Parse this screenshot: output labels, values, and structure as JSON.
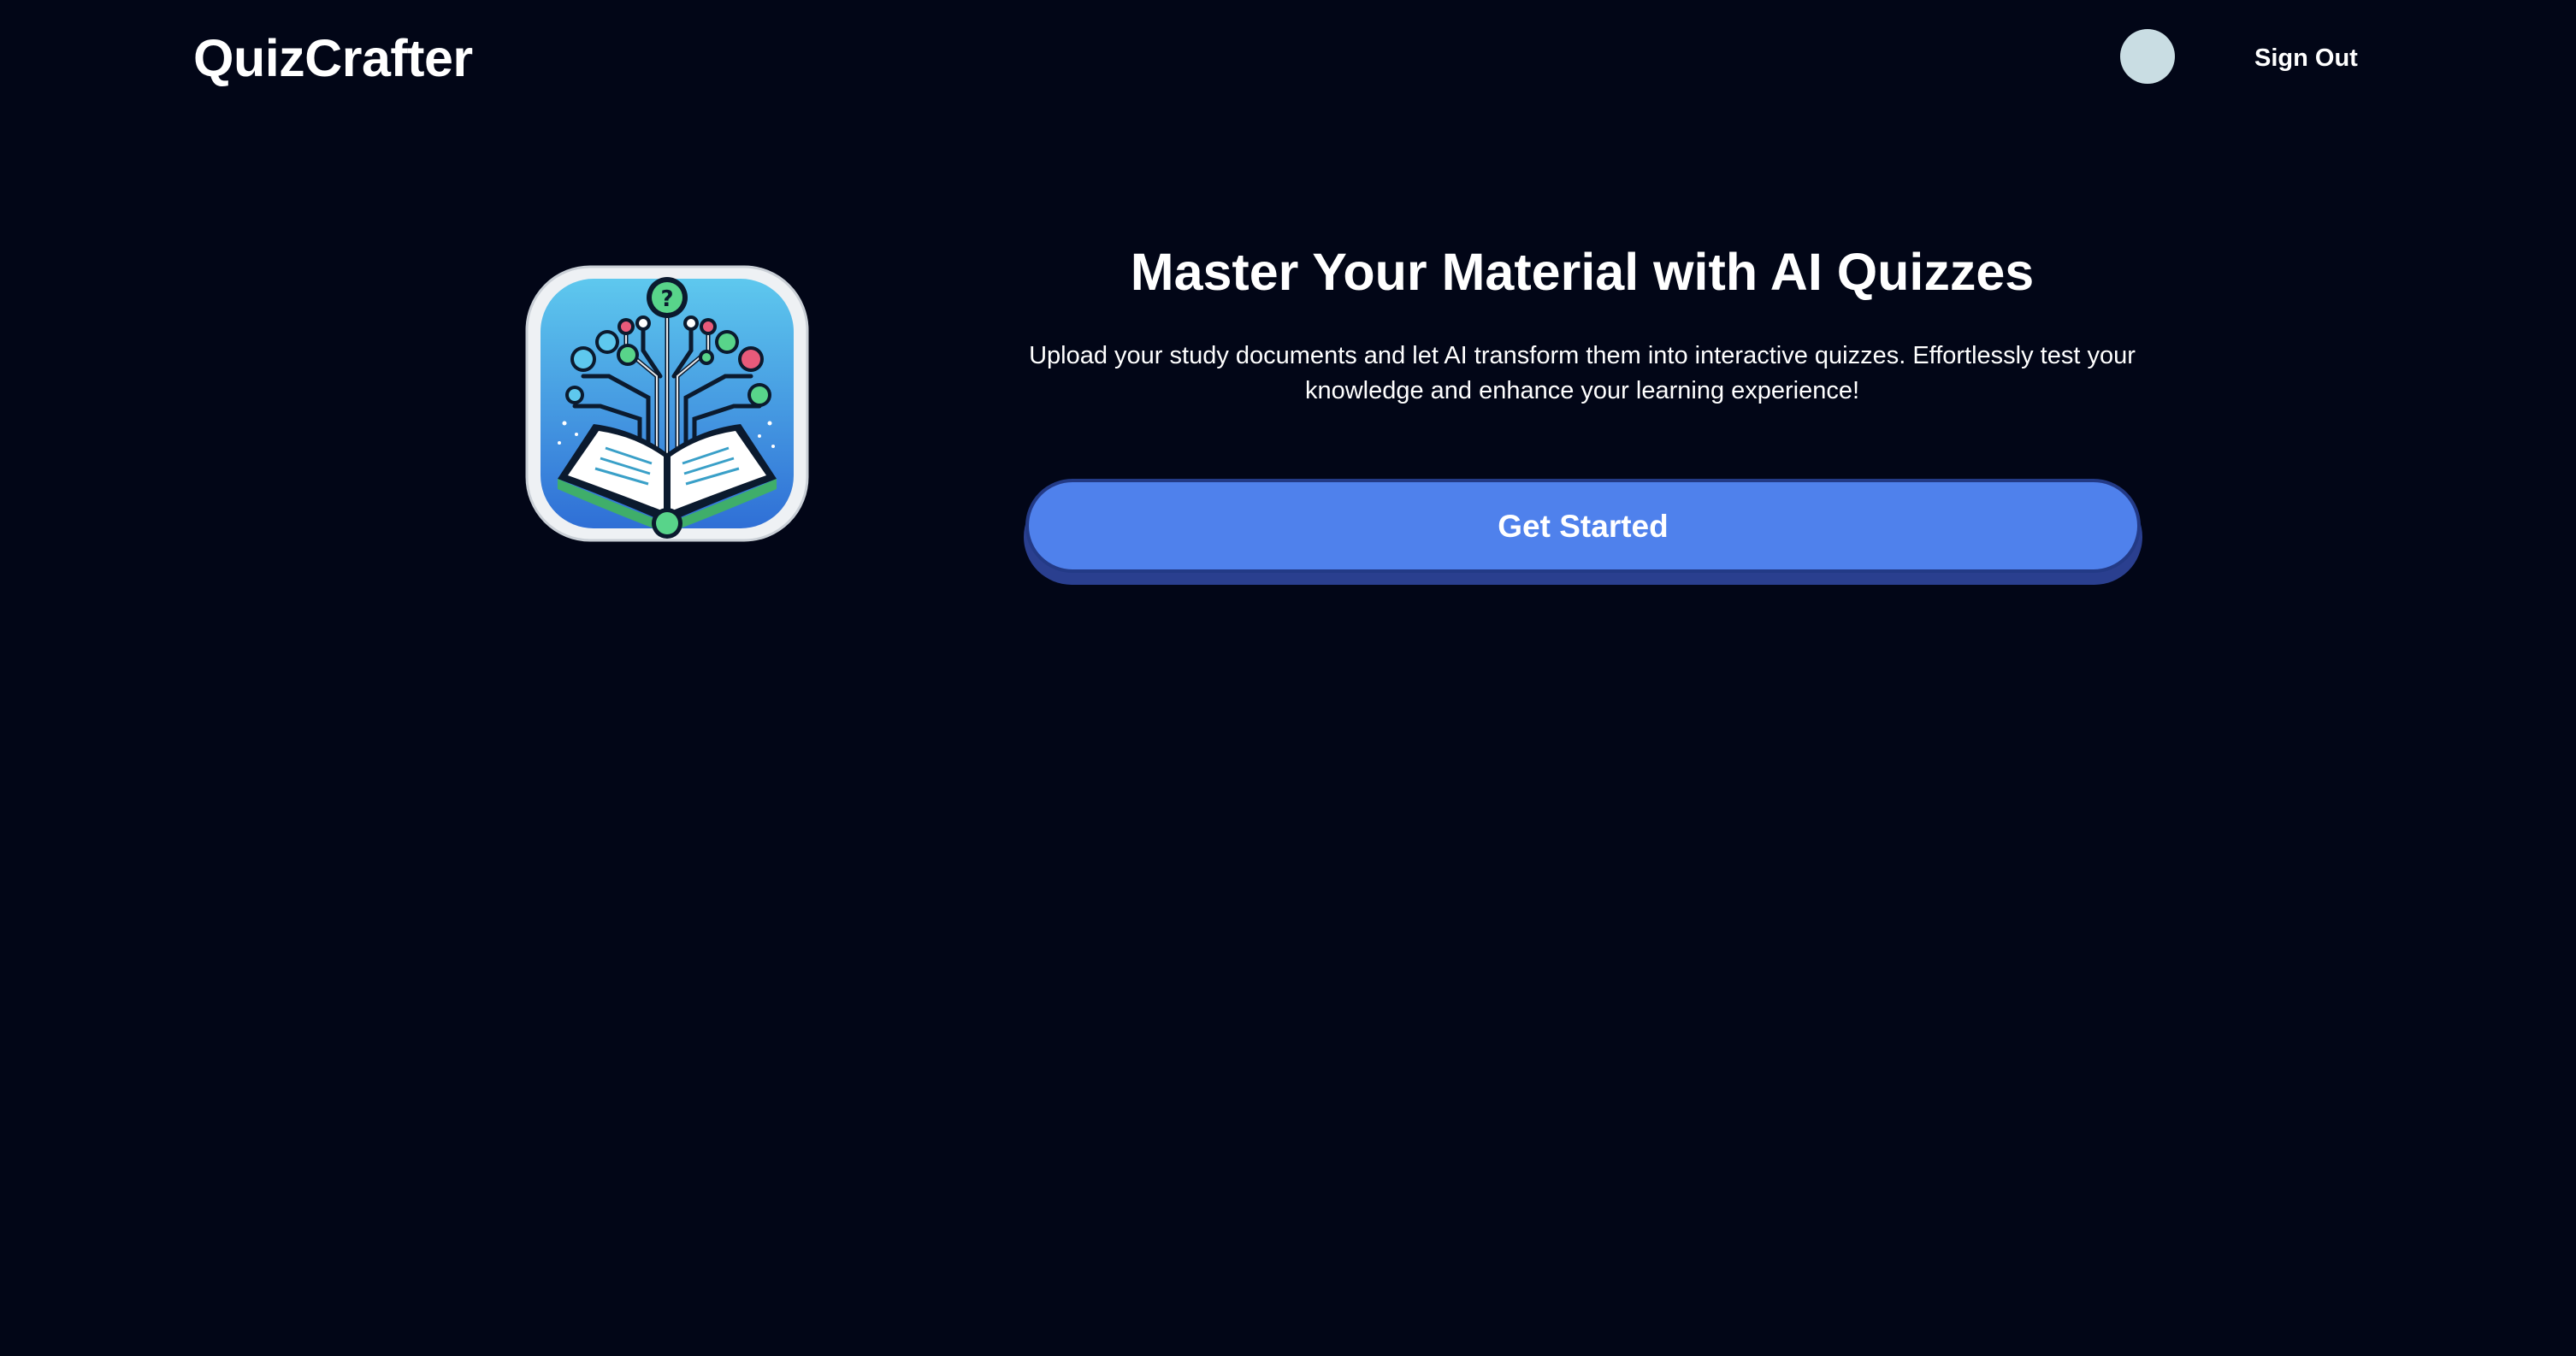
{
  "header": {
    "brand": "QuizCrafter",
    "signout_label": "Sign Out",
    "avatar_color": "#c9dde3"
  },
  "hero": {
    "title": "Master Your Material with AI Quizzes",
    "description": "Upload your study documents and let AI transform them into interactive quizzes. Effortlessly test your knowledge and enhance your learning experience!",
    "cta_label": "Get Started",
    "logo_icon": "book-ai-tree-icon"
  },
  "colors": {
    "background": "#020617",
    "accent": "#4f81ec",
    "accent_dark": "#233a86",
    "text": "#ffffff"
  }
}
